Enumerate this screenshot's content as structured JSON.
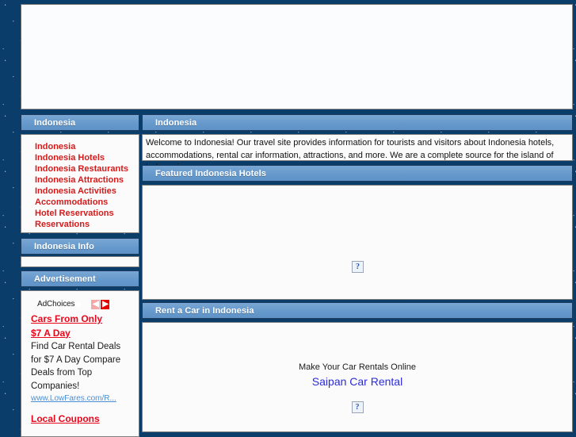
{
  "page": {
    "title": "Indonesia",
    "accent_blue": "#6699cc",
    "accent_border": "#1b3a5c",
    "link_red": "#d61a1a",
    "background_navy": "#0b3d6b"
  },
  "banner": {
    "name": "top-banner-ad-slot",
    "content": ""
  },
  "sidebar": {
    "nav_header": "Indonesia",
    "nav_items": [
      {
        "label": "Indonesia"
      },
      {
        "label": "Indonesia Hotels"
      },
      {
        "label": "Indonesia Restaurants"
      },
      {
        "label": "Indonesia Attractions"
      },
      {
        "label": "Indonesia Activities"
      },
      {
        "label": "Accommodations"
      },
      {
        "label": "Hotel Reservations"
      },
      {
        "label": "Reservations"
      }
    ],
    "info_header": "Indonesia Info",
    "info_body": "",
    "ad_header": "Advertisement",
    "ad": {
      "adchoices_label": "AdChoices",
      "prev_arrow": "◀",
      "next_arrow": "▶",
      "title_line1": "Cars From Only",
      "title_line2": "$7 A Day",
      "body": "Find Car Rental Deals for $7 A Day Compare Deals from Top Companies!",
      "url": "www.LowFares.com/R...",
      "next_ad_title": "Local Coupons"
    }
  },
  "main": {
    "intro_header": "Indonesia",
    "intro_text": "Welcome to Indonesia!  Our travel site provides information for tourists and visitors about Indonesia hotels, accommodations, rental car information, attractions, and more.  We are a complete source for the island of Indonesia.",
    "hotels_header": "Featured Indonesia Hotels",
    "hotels_placeholder_glyph": "?",
    "rental_header": "Rent a Car in Indonesia",
    "rental_tagline": "Make Your Car Rentals Online",
    "rental_link": "Saipan Car Rental",
    "rental_placeholder_glyph": "?"
  }
}
